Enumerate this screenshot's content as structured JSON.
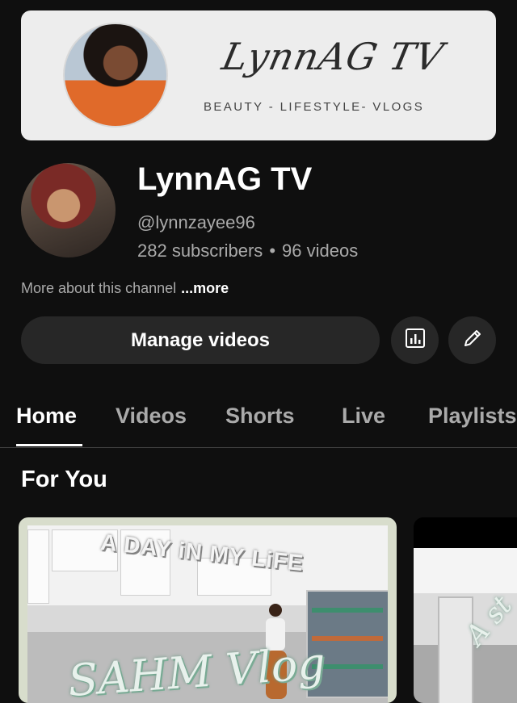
{
  "banner": {
    "script_title": "LynnAG TV",
    "tagline": "BEAUTY - LIFESTYLE- VLOGS"
  },
  "channel": {
    "name": "LynnAG TV",
    "handle": "@lynnzayee96",
    "subscribers": "282 subscribers",
    "separator": "•",
    "videos": "96 videos",
    "about": "More about this channel",
    "about_more": "...more"
  },
  "actions": {
    "manage_videos": "Manage videos",
    "analytics_icon": "bar-chart-icon",
    "edit_icon": "pencil-icon"
  },
  "tabs": [
    {
      "label": "Home",
      "active": true
    },
    {
      "label": "Videos",
      "active": false
    },
    {
      "label": "Shorts",
      "active": false
    },
    {
      "label": "Live",
      "active": false
    },
    {
      "label": "Playlists",
      "active": false
    }
  ],
  "section": {
    "title": "For You"
  },
  "videos": [
    {
      "thumb_title": "A DAY iN MY LiFE",
      "thumb_script": "SAHM Vlog"
    },
    {
      "thumb_script": "A st"
    }
  ],
  "colors": {
    "background": "#0f0f0f",
    "surface": "#272727",
    "secondary_text": "#aaaaaa",
    "banner_bg": "#ededed"
  }
}
